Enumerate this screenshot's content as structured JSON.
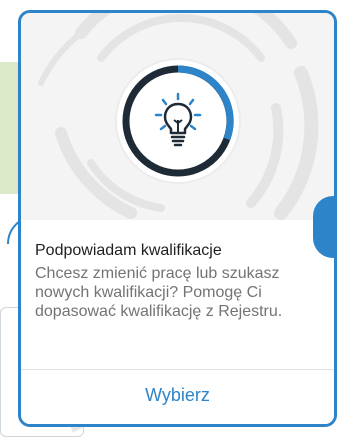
{
  "card": {
    "title": "Podpowiadam kwalifikacje",
    "description": "Chcesz zmienić pracę lub szukasz nowych kwalifikacji? Pomogę Ci dopasować kwalifikację z Rejestru.",
    "action_label": "Wybierz",
    "icon": "lightbulb-icon"
  },
  "colors": {
    "accent": "#2d84c8",
    "hero_background": "#f4f4f4",
    "title": "#1f1f1f",
    "description": "#737373"
  },
  "background": {
    "left_tile_color": "#dce9c8"
  }
}
